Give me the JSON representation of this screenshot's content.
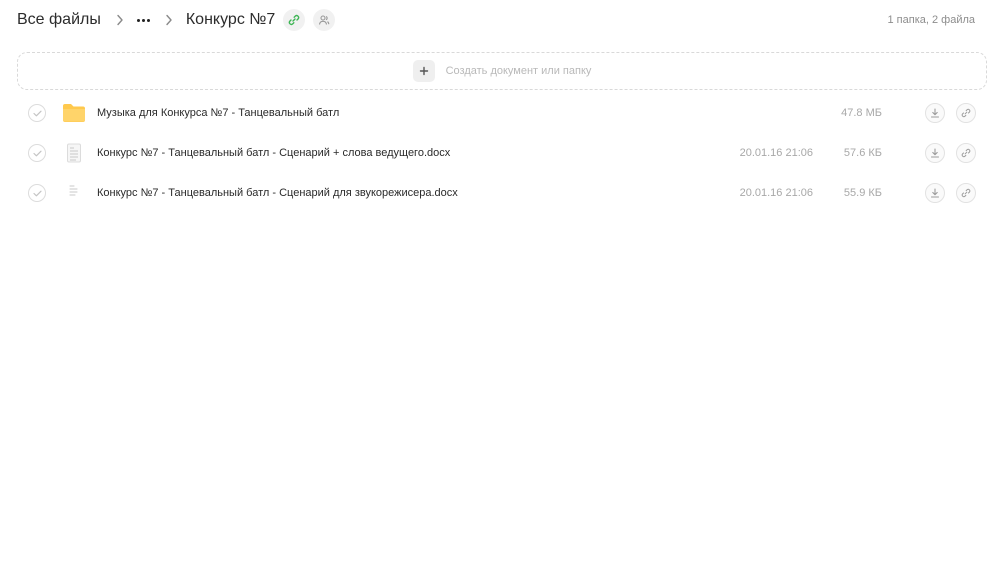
{
  "breadcrumb": {
    "root": "Все файлы",
    "current": "Конкурс №7"
  },
  "summary": "1 папка, 2 файла",
  "create": {
    "label": "Создать документ или папку"
  },
  "icons": {
    "share_link_color": "#3db554",
    "folder_color": "#ffc94d",
    "muted_icon_color": "#b5b5b5"
  },
  "files": [
    {
      "type": "folder",
      "name": "Музыка для Конкурса №7 - Танцевальный батл",
      "date": "",
      "size": "47.8 МБ"
    },
    {
      "type": "docx",
      "name": "Конкурс №7 - Танцевальный батл - Сценарий + слова ведущего.docx",
      "date": "20.01.16 21:06",
      "size": "57.6 КБ"
    },
    {
      "type": "docx",
      "name": "Конкурс №7 - Танцевальный батл - Сценарий для звукорежисера.docx",
      "date": "20.01.16 21:06",
      "size": "55.9 КБ"
    }
  ]
}
